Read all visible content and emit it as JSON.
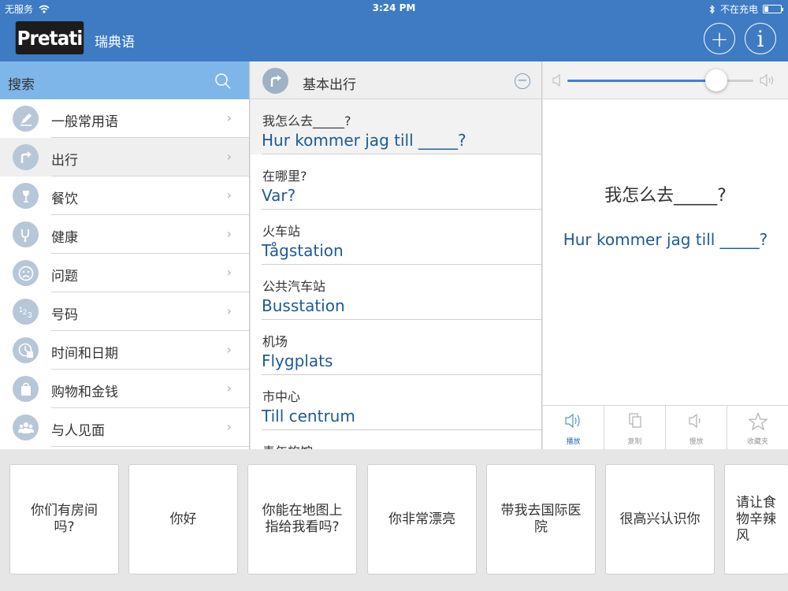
{
  "status": {
    "carrier": "无服务",
    "time": "3:24 PM",
    "battery": "不在充电"
  },
  "header": {
    "logo": "Pretati",
    "language": "瑞典语",
    "add_label": "+",
    "info_label": "i"
  },
  "sidebar": {
    "search_label": "搜索",
    "items": [
      {
        "label": "一般常用语"
      },
      {
        "label": "出行"
      },
      {
        "label": "餐饮"
      },
      {
        "label": "健康"
      },
      {
        "label": "问题"
      },
      {
        "label": "号码"
      },
      {
        "label": "时间和日期"
      },
      {
        "label": "购物和金钱"
      },
      {
        "label": "与人见面"
      }
    ]
  },
  "list": {
    "title": "基本出行",
    "phrases": [
      {
        "zh": "我怎么去_____?",
        "sv": "Hur kommer jag till _____?"
      },
      {
        "zh": "在哪里?",
        "sv": "Var?"
      },
      {
        "zh": "火车站",
        "sv": "Tågstation"
      },
      {
        "zh": "公共汽车站",
        "sv": "Busstation"
      },
      {
        "zh": "机场",
        "sv": "Flygplats"
      },
      {
        "zh": "市中心",
        "sv": "Till centrum"
      },
      {
        "zh": "青年旅馆",
        "sv": ""
      }
    ]
  },
  "detail": {
    "zh": "我怎么去_____?",
    "sv": "Hur kommer jag till _____?",
    "volume": 0.8,
    "actions": [
      {
        "label": "播放"
      },
      {
        "label": "复制"
      },
      {
        "label": "慢放"
      },
      {
        "label": "收藏夹"
      }
    ]
  },
  "suggestions": [
    {
      "text": "你们有房间吗?"
    },
    {
      "text": "你好"
    },
    {
      "text": "你能在地图上指给我看吗?"
    },
    {
      "text": "你非常漂亮"
    },
    {
      "text": "带我去国际医院"
    },
    {
      "text": "很高兴认识你"
    },
    {
      "text": "请让食物辛辣风"
    }
  ],
  "colors": {
    "header_bg": "#3e7bc2",
    "search_bg": "#7fb6ea",
    "swedish_text": "#1e5a96",
    "slider_fill": "#3b7ee0"
  }
}
